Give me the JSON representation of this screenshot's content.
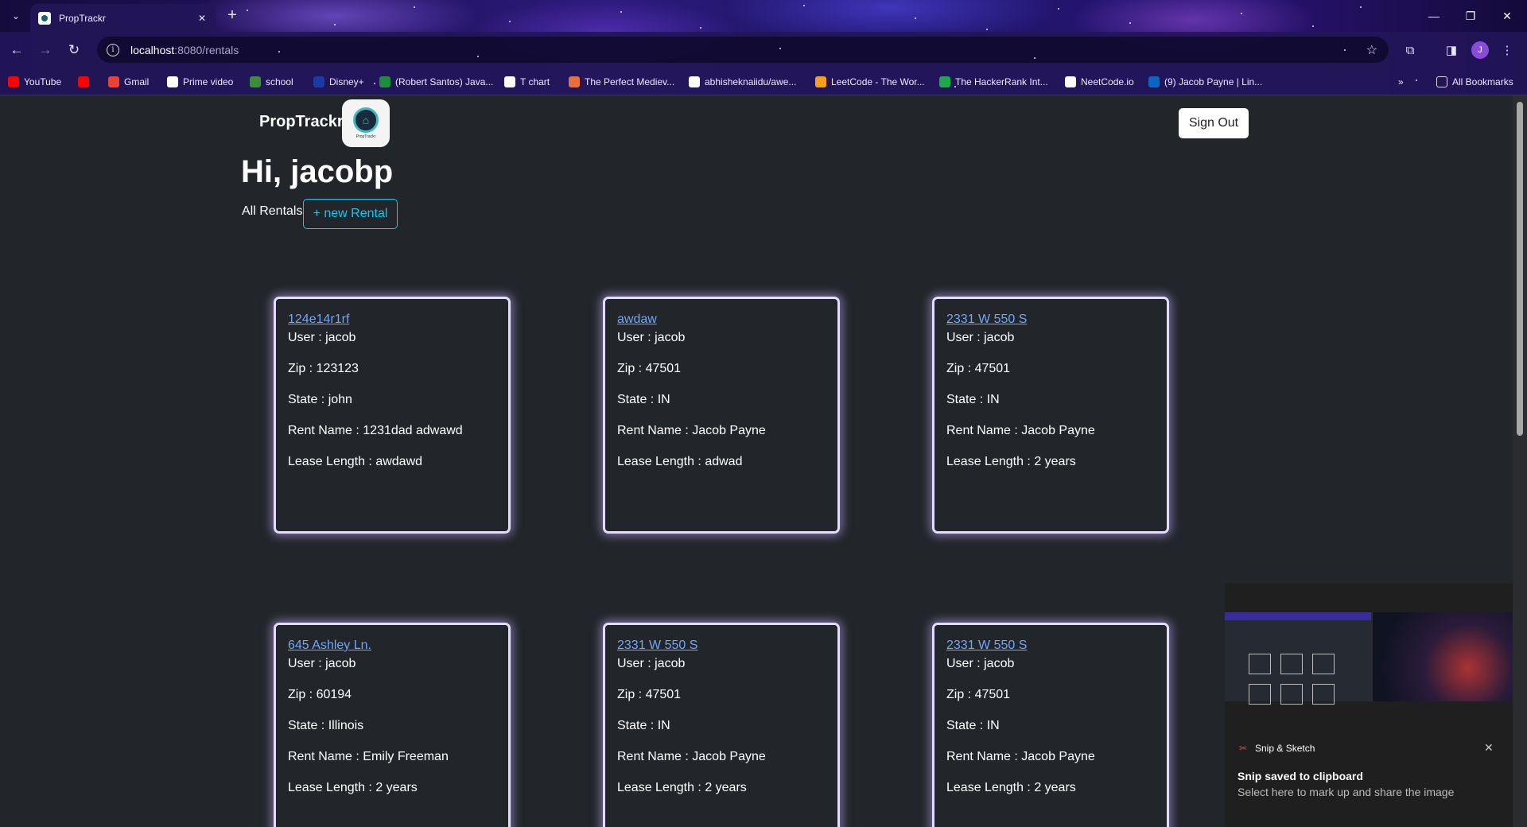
{
  "browser": {
    "tab_title": "PropTrackr",
    "url_host": "localhost",
    "url_path": ":8080/rentals",
    "profile_initial": "J",
    "bookmarks": [
      {
        "label": "YouTube",
        "icon": "youtube-icon",
        "color": "#ff0000"
      },
      {
        "label": "",
        "icon": "youtube-icon",
        "color": "#ff0000"
      },
      {
        "label": "Gmail",
        "icon": "gmail-icon",
        "color": "#ea4335"
      },
      {
        "label": "Prime video",
        "icon": "amazon-icon",
        "color": "#ffffff"
      },
      {
        "label": "school",
        "icon": "school-icon",
        "color": "#3b8d3b"
      },
      {
        "label": "Disney+",
        "icon": "disney-icon",
        "color": "#1a3aa8"
      },
      {
        "label": "(Robert Santos) Java...",
        "icon": "sheets-icon",
        "color": "#1e8e3e"
      },
      {
        "label": "T chart",
        "icon": "tchart-icon",
        "color": "#ffffff"
      },
      {
        "label": "The Perfect Mediev...",
        "icon": "medieval-icon",
        "color": "#e8703a"
      },
      {
        "label": "abhisheknaiidu/awe...",
        "icon": "github-icon",
        "color": "#ffffff"
      },
      {
        "label": "LeetCode - The Wor...",
        "icon": "leetcode-icon",
        "color": "#f89f1b"
      },
      {
        "label": "The HackerRank Int...",
        "icon": "hackerrank-icon",
        "color": "#1ba94c"
      },
      {
        "label": "NeetCode.io",
        "icon": "neetcode-icon",
        "color": "#ffffff"
      },
      {
        "label": "(9) Jacob Payne | Lin...",
        "icon": "linkedin-icon",
        "color": "#0a66c2"
      }
    ],
    "all_bookmarks": "All Bookmarks"
  },
  "header": {
    "brand": "PropTrackr",
    "logo_text": "PropTrackr",
    "signout_label": "Sign Out"
  },
  "main": {
    "greeting": "Hi, jacobp",
    "all_rentals_label": "All Rentals",
    "new_rental_label": "+ new Rental"
  },
  "labels": {
    "user": "User : ",
    "zip": "Zip : ",
    "state": "State : ",
    "rent_name": "Rent Name : ",
    "lease_length": "Lease Length : "
  },
  "rentals": [
    {
      "address": "124e14r1rf",
      "user": "jacob",
      "zip": "123123",
      "state": "john",
      "rent_name": "1231dad adwawd",
      "lease_length": "awdawd"
    },
    {
      "address": "awdaw",
      "user": "jacob",
      "zip": "47501",
      "state": "IN",
      "rent_name": "Jacob Payne",
      "lease_length": "adwad"
    },
    {
      "address": "2331 W 550 S",
      "user": "jacob",
      "zip": "47501",
      "state": "IN",
      "rent_name": "Jacob Payne",
      "lease_length": "2 years"
    },
    {
      "address": "645 Ashley Ln.",
      "user": "jacob",
      "zip": "60194",
      "state": "Illinois",
      "rent_name": "Emily Freeman",
      "lease_length": "2 years"
    },
    {
      "address": "2331 W 550 S",
      "user": "jacob",
      "zip": "47501",
      "state": "IN",
      "rent_name": "Jacob Payne",
      "lease_length": "2 years"
    },
    {
      "address": "2331 W 550 S",
      "user": "jacob",
      "zip": "47501",
      "state": "IN",
      "rent_name": "Jacob Payne",
      "lease_length": "2 years"
    }
  ],
  "toast": {
    "app_name": "Snip & Sketch",
    "title": "Snip saved to clipboard",
    "subtitle": "Select here to mark up and share the image"
  }
}
